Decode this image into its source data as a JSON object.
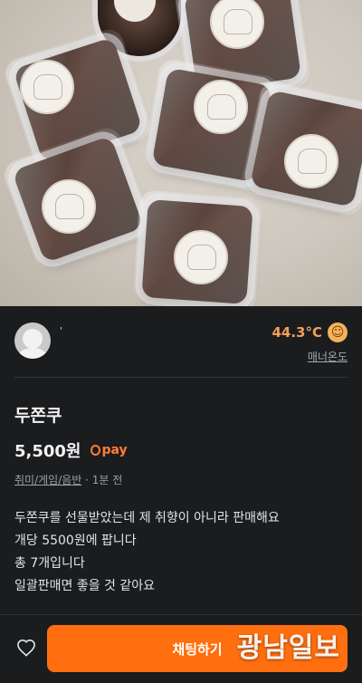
{
  "seller": {
    "nickname": "'",
    "manner_temp": "44.3°C",
    "manner_label": "매너온도",
    "temp_icon": "smile-face-icon"
  },
  "product": {
    "title": "두쫀쿠",
    "price": "5,500원",
    "pay_label": "pay",
    "category": "취미/게임/음반",
    "time": "· 1분 전",
    "description": [
      "두쫀쿠를 선물받았는데 제 취향이 아니라 판매해요",
      "개당 5500원에 팝니다",
      "총 7개입니다",
      "일괄판매면 좋을 것 같아요"
    ]
  },
  "bottom_bar": {
    "chat_button": "채팅하기",
    "heart_icon": "heart-outline-icon"
  },
  "watermark": "광남일보",
  "colors": {
    "accent": "#ff6f0f",
    "temp": "#f0a05a",
    "background": "#1b1c1e"
  }
}
